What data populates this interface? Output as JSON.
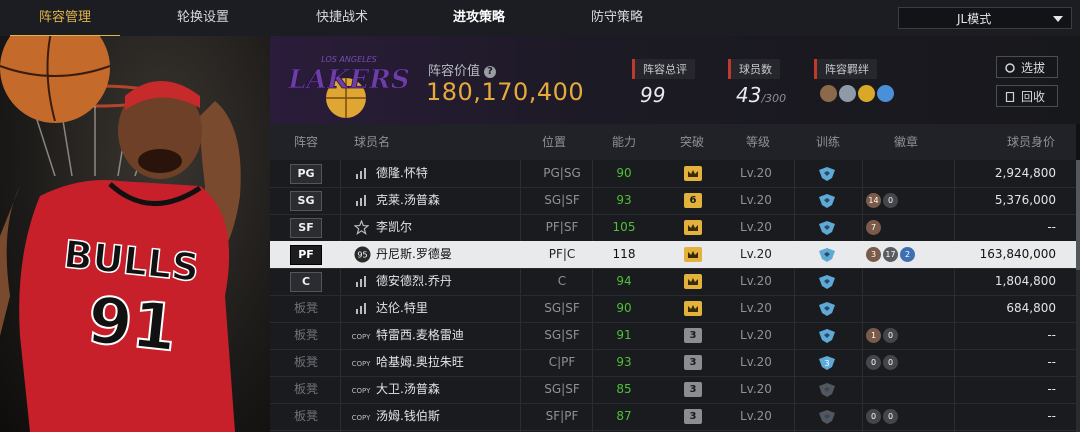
{
  "tabs": [
    "阵容管理",
    "轮换设置",
    "快捷战术",
    "进攻策略",
    "防守策略"
  ],
  "mode_select": {
    "value": "JL模式"
  },
  "summary": {
    "team_logo": {
      "line1": "LOS ANGELES",
      "line2": "LAKERS"
    },
    "value_label": "阵容价值",
    "value": "180,170,400",
    "rating_label": "阵容总评",
    "rating": "99",
    "players_label": "球员数",
    "players": "43",
    "players_max": "/300",
    "bond_label": "阵容羁绊",
    "select_btn": "选拔",
    "recycle_btn": "回收"
  },
  "colors": {
    "accent": "#e0b64a",
    "value": "#e6a93c",
    "green": "#4fbf3a"
  },
  "table": {
    "headers": [
      "阵容",
      "球员名",
      "位置",
      "能力",
      "突破",
      "等级",
      "训练",
      "徽章",
      "球员身价"
    ],
    "rows": [
      {
        "slot": "PG",
        "bench": false,
        "name": "德隆.怀特",
        "pos": "PG|SG",
        "ability": "90",
        "break": "crown",
        "level": "Lv.20",
        "train": "blue",
        "badges": [],
        "price": "2,924,800",
        "selected": false,
        "icon": "bars"
      },
      {
        "slot": "SG",
        "bench": false,
        "name": "克莱.汤普森",
        "pos": "SG|SF",
        "ability": "93",
        "break": "6",
        "level": "Lv.20",
        "train": "blue",
        "badges": [
          "14",
          "0"
        ],
        "price": "5,376,000",
        "selected": false,
        "icon": "bars"
      },
      {
        "slot": "SF",
        "bench": false,
        "name": "李凯尔",
        "pos": "PF|SF",
        "ability": "105",
        "break": "crown",
        "level": "Lv.20",
        "train": "blue",
        "badges": [
          "7"
        ],
        "price": "--",
        "selected": false,
        "icon": "star"
      },
      {
        "slot": "PF",
        "bench": false,
        "name": "丹尼斯.罗德曼",
        "pos": "PF|C",
        "ability": "118",
        "break": "crown",
        "level": "Lv.20",
        "train": "blue",
        "badges": [
          "3",
          "17",
          "2"
        ],
        "price": "163,840,000",
        "selected": true,
        "icon": "95"
      },
      {
        "slot": "C",
        "bench": false,
        "name": "德安德烈.乔丹",
        "pos": "C",
        "ability": "94",
        "break": "crown",
        "level": "Lv.20",
        "train": "blue",
        "badges": [],
        "price": "1,804,800",
        "selected": false,
        "icon": "bars"
      },
      {
        "slot": "板凳",
        "bench": true,
        "name": "达伦.特里",
        "pos": "SG|SF",
        "ability": "90",
        "break": "crown",
        "level": "Lv.20",
        "train": "blue",
        "badges": [],
        "price": "684,800",
        "selected": false,
        "icon": "bars"
      },
      {
        "slot": "板凳",
        "bench": true,
        "name": "特雷西.麦格雷迪",
        "pos": "SG|SF",
        "ability": "91",
        "break": "3",
        "level": "Lv.20",
        "train": "blue",
        "badges": [
          "1",
          "0"
        ],
        "price": "--",
        "selected": false,
        "icon": "copy"
      },
      {
        "slot": "板凳",
        "bench": true,
        "name": "哈基姆.奥拉朱旺",
        "pos": "C|PF",
        "ability": "93",
        "break": "3",
        "level": "Lv.20",
        "train": "blue3",
        "badges": [
          "0",
          "0"
        ],
        "price": "--",
        "selected": false,
        "icon": "copy"
      },
      {
        "slot": "板凳",
        "bench": true,
        "name": "大卫.汤普森",
        "pos": "SG|SF",
        "ability": "85",
        "break": "3",
        "level": "Lv.20",
        "train": "gray",
        "badges": [],
        "price": "--",
        "selected": false,
        "icon": "copy"
      },
      {
        "slot": "板凳",
        "bench": true,
        "name": "汤姆.钱伯斯",
        "pos": "SF|PF",
        "ability": "87",
        "break": "3",
        "level": "Lv.20",
        "train": "gray",
        "badges": [
          "0",
          "0"
        ],
        "price": "--",
        "selected": false,
        "icon": "copy"
      }
    ]
  },
  "player_art": {
    "jersey_text": "BULLS",
    "jersey_number": "91"
  }
}
